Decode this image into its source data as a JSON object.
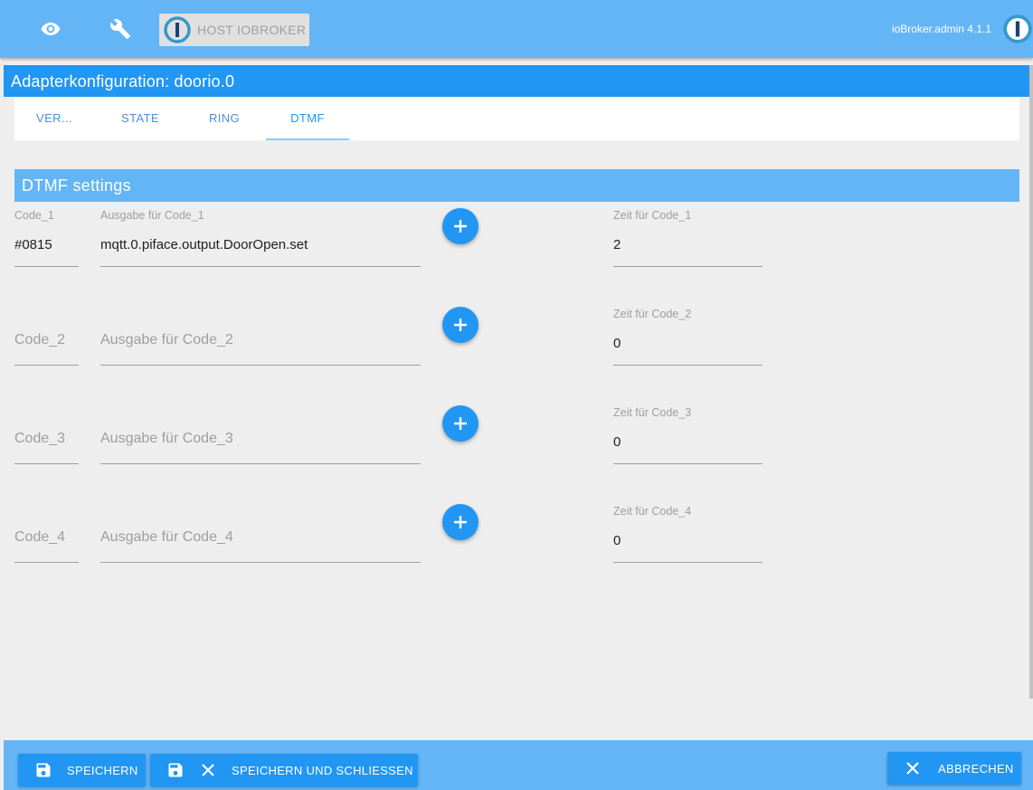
{
  "topbar": {
    "icons": [
      "eye-icon",
      "wrench-icon"
    ],
    "host_label": "HOST IOBROKER",
    "version": "ioBroker.admin 4.1.1"
  },
  "title": "Adapterkonfiguration: doorio.0",
  "tabs": [
    {
      "label": "VER..."
    },
    {
      "label": "STATE"
    },
    {
      "label": "RING"
    },
    {
      "label": "DTMF",
      "active": true
    }
  ],
  "section": {
    "title": "DTMF settings"
  },
  "rows": [
    {
      "code_label": "Code_1",
      "code_value": "#0815",
      "output_label": "Ausgabe für Code_1",
      "output_value": "mqtt.0.piface.output.DoorOpen.set",
      "time_label": "Zeit für Code_1",
      "time_value": "2"
    },
    {
      "code_label": "Code_2",
      "code_value": "",
      "output_label": "Ausgabe für Code_2",
      "output_value": "",
      "time_label": "Zeit für Code_2",
      "time_value": "0"
    },
    {
      "code_label": "Code_3",
      "code_value": "",
      "output_label": "Ausgabe für Code_3",
      "output_value": "",
      "time_label": "Zeit für Code_3",
      "time_value": "0"
    },
    {
      "code_label": "Code_4",
      "code_value": "",
      "output_label": "Ausgabe für Code_4",
      "output_value": "",
      "time_label": "Zeit für Code_4",
      "time_value": "0"
    }
  ],
  "footer": {
    "save_label": "SPEICHERN",
    "save_close_label": "SPEICHERN UND SCHLIESSEN",
    "cancel_label": "ABBRECHEN"
  },
  "colors": {
    "topbar": "#64b5f6",
    "title_bar": "#2196f3",
    "accent": "#2196f3",
    "background": "#eeeeee"
  }
}
